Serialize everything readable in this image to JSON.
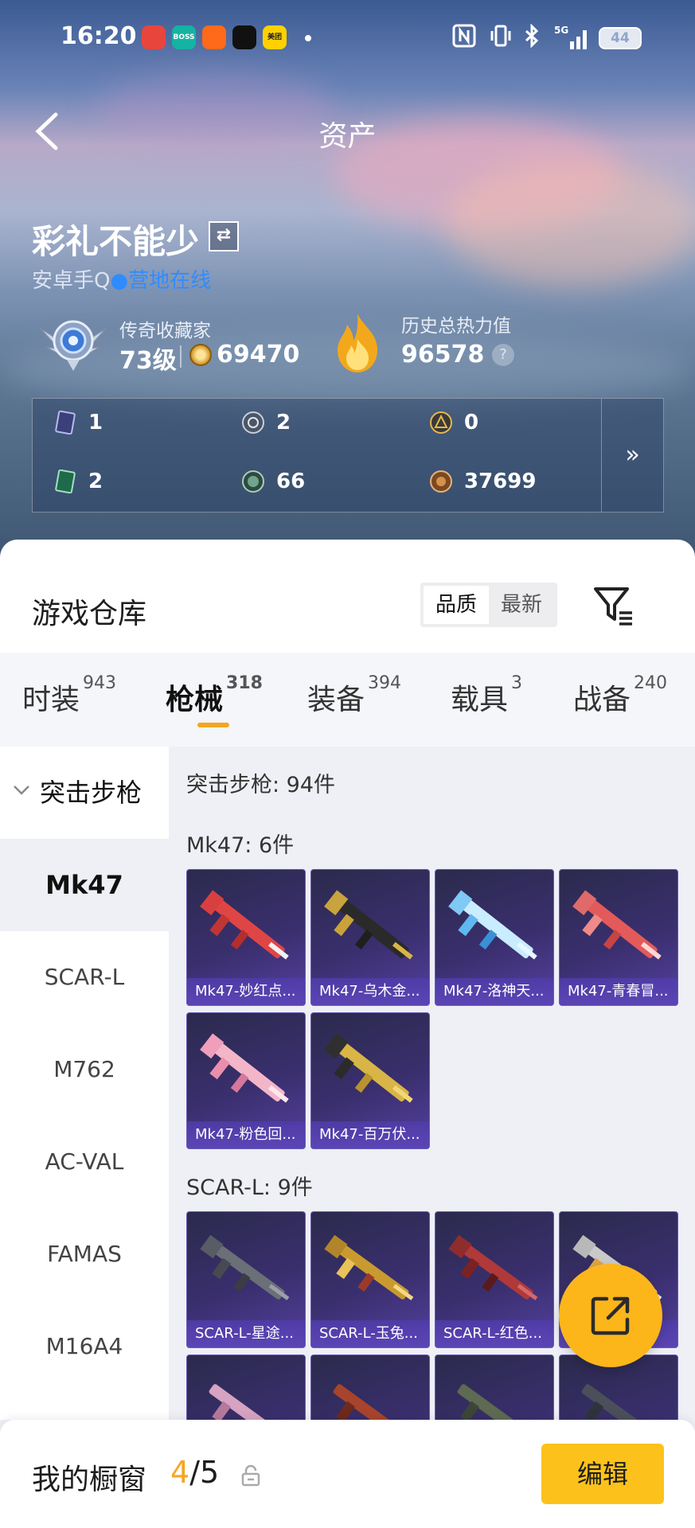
{
  "status_bar": {
    "time": "16:20",
    "apps": [
      {
        "icon": "red-app-icon",
        "text": "",
        "color": "#e8453c"
      },
      {
        "icon": "boss-app-icon",
        "text": "BOSS",
        "color": "#15b3a2"
      },
      {
        "icon": "orange-app-icon",
        "text": "",
        "color": "#ff6a1a"
      },
      {
        "icon": "tiktok-app-icon",
        "text": "",
        "color": "#111111"
      },
      {
        "icon": "meituan-app-icon",
        "text": "美团",
        "color": "#ffd100"
      }
    ],
    "network": "5G",
    "battery": "44"
  },
  "header": {
    "title": "资产",
    "username": "彩礼不能少",
    "swap_icon": "⇄",
    "platform": "安卓手Q",
    "online_status": "营地在线",
    "collector_label": "传奇收藏家",
    "level": "73级",
    "coins": "69470",
    "heat_label": "历史总热力值",
    "heat_value": "96578",
    "help": "?",
    "resources": [
      {
        "icon": "purple-card-icon",
        "value": "1"
      },
      {
        "icon": "silver-coin-icon",
        "value": "2"
      },
      {
        "icon": "gold-coin-icon",
        "value": "0"
      },
      {
        "icon": "green-card-icon",
        "value": "2"
      },
      {
        "icon": "green-orb-icon",
        "value": "66"
      },
      {
        "icon": "bronze-coin-icon",
        "value": "37699"
      }
    ],
    "more": "»"
  },
  "warehouse": {
    "title": "游戏仓库",
    "sort_options": [
      "品质",
      "最新"
    ],
    "selected_sort": "品质"
  },
  "tabs": [
    {
      "label": "时装",
      "count": "943"
    },
    {
      "label": "枪械",
      "count": "318"
    },
    {
      "label": "装备",
      "count": "394"
    },
    {
      "label": "载具",
      "count": "3"
    },
    {
      "label": "战备",
      "count": "240"
    }
  ],
  "sidebar": {
    "category": "突击步枪",
    "items": [
      "Mk47",
      "SCAR-L",
      "M762",
      "AC-VAL",
      "FAMAS",
      "M16A4"
    ],
    "active": "Mk47"
  },
  "content": {
    "category_summary": "突击步枪: 94件",
    "groups": [
      {
        "title": "Mk47: 6件",
        "items": [
          "Mk47-妙红点...",
          "Mk47-乌木金...",
          "Mk47-洛神天...",
          "Mk47-青春冒...",
          "Mk47-粉色回...",
          "Mk47-百万伏..."
        ]
      },
      {
        "title": "SCAR-L: 9件",
        "items": [
          "SCAR-L-星途...",
          "SCAR-L-玉兔...",
          "SCAR-L-红色...",
          "SCAR-L-..."
        ]
      }
    ]
  },
  "bottom_bar": {
    "label": "我的橱窗",
    "current": "4",
    "total": "/5",
    "edit": "编辑"
  },
  "colors": {
    "accent": "#fcc21b",
    "online": "#2f8cff",
    "card_bg": "#3a2f6e"
  }
}
